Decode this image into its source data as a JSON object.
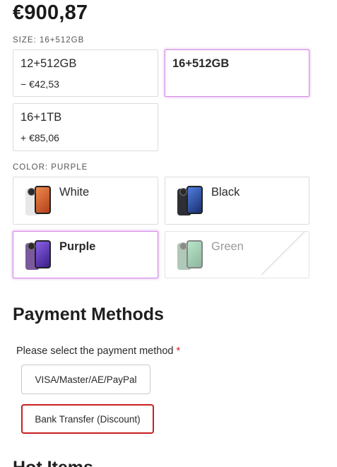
{
  "price": "€900,87",
  "size": {
    "label": "SIZE: 16+512GB",
    "options": [
      {
        "name": "12+512GB",
        "delta": "− €42,53",
        "selected": false
      },
      {
        "name": "16+512GB",
        "delta": "",
        "selected": true
      },
      {
        "name": "16+1TB",
        "delta": "+ €85,06",
        "selected": false
      }
    ]
  },
  "color": {
    "label": "COLOR: PURPLE",
    "options": [
      {
        "name": "White",
        "selected": false,
        "available": true,
        "icon": "phone-white-icon",
        "back": "#e8e8e8",
        "accent": "#e7683a"
      },
      {
        "name": "Black",
        "selected": false,
        "available": true,
        "icon": "phone-black-icon",
        "back": "#2d2f35",
        "accent": "#3b63c9"
      },
      {
        "name": "Purple",
        "selected": true,
        "available": true,
        "icon": "phone-purple-icon",
        "back": "#7a5a9c",
        "accent": "#6b3fd0"
      },
      {
        "name": "Green",
        "selected": false,
        "available": false,
        "icon": "phone-green-icon",
        "back": "#6f9c7c",
        "accent": "#3aa86b"
      }
    ]
  },
  "payment": {
    "title": "Payment Methods",
    "prompt": "Please select the payment method",
    "required_mark": "*",
    "methods": [
      {
        "label": "VISA/Master/AE/PayPal",
        "active": false
      },
      {
        "label": "Bank Transfer (Discount)",
        "active": true
      }
    ]
  },
  "hot_items_title": "Hot Items",
  "colors": {
    "selected_border": "#d48ae6",
    "active_payment_border": "#c8201f",
    "required": "#d21f1f"
  }
}
